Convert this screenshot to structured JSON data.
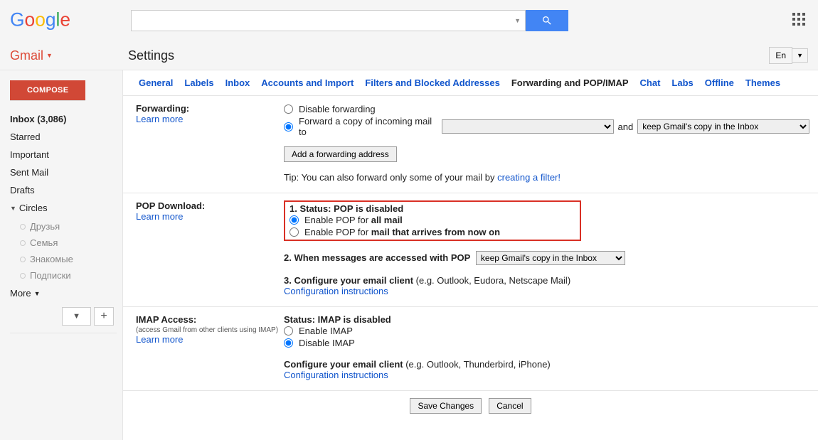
{
  "header": {
    "search_placeholder": ""
  },
  "subheader": {
    "gmail_label": "Gmail",
    "title": "Settings",
    "lang": "En"
  },
  "sidebar": {
    "compose": "COMPOSE",
    "items": [
      {
        "label": "Inbox (3,086)",
        "bold": true
      },
      {
        "label": "Starred"
      },
      {
        "label": "Important"
      },
      {
        "label": "Sent Mail"
      },
      {
        "label": "Drafts"
      }
    ],
    "circles_label": "Circles",
    "circles": [
      "Друзья",
      "Семья",
      "Знакомые",
      "Подписки"
    ],
    "more": "More",
    "dropdown_arrow": "▼"
  },
  "tabs": [
    "General",
    "Labels",
    "Inbox",
    "Accounts and Import",
    "Filters and Blocked Addresses",
    "Forwarding and POP/IMAP",
    "Chat",
    "Labs",
    "Offline",
    "Themes"
  ],
  "active_tab_index": 5,
  "forwarding": {
    "title": "Forwarding:",
    "learn_more": "Learn more",
    "disable": "Disable forwarding",
    "forward_prefix": "Forward a copy of incoming mail to",
    "and_label": "and",
    "address_select": " ",
    "keep_select": "keep Gmail's copy in the Inbox",
    "add_btn": "Add a forwarding address",
    "tip_prefix": "Tip: You can also forward only some of your mail by ",
    "tip_link": "creating a filter!"
  },
  "pop": {
    "title": "POP Download:",
    "learn_more": "Learn more",
    "status_label": "1. Status: ",
    "status_value": "POP is disabled",
    "enable_all_prefix": "Enable POP for ",
    "enable_all_bold": "all mail",
    "enable_now_prefix": "Enable POP for ",
    "enable_now_bold": "mail that arrives from now on",
    "step2_label": "2. When messages are accessed with POP",
    "step2_select": "keep Gmail's copy in the Inbox",
    "step3_label": "3. Configure your email client ",
    "step3_hint": "(e.g. Outlook, Eudora, Netscape Mail)",
    "config_link": "Configuration instructions"
  },
  "imap": {
    "title": "IMAP Access:",
    "note": "(access Gmail from other clients using IMAP)",
    "learn_more": "Learn more",
    "status_label": "Status: ",
    "status_value": "IMAP is disabled",
    "enable": "Enable IMAP",
    "disable": "Disable IMAP",
    "config_label": "Configure your email client ",
    "config_hint": "(e.g. Outlook, Thunderbird, iPhone)",
    "config_link": "Configuration instructions"
  },
  "footer": {
    "save": "Save Changes",
    "cancel": "Cancel"
  }
}
